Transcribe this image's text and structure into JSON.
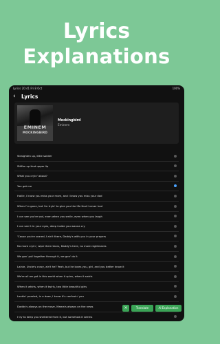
{
  "headline": {
    "line1": "Lyrics",
    "line2": "Explanations"
  },
  "status": {
    "carrier": "Lyrics",
    "time": "20:41",
    "date": "Fri 8 Oct",
    "right": "100%"
  },
  "nav": {
    "back_glyph": "‹",
    "title": "Lyrics"
  },
  "song": {
    "title": "Mockingbird",
    "artist": "Eminem",
    "cover_artist_text": "EMINEM",
    "cover_title_text": "MOCKINGBIRD"
  },
  "lyrics": [
    {
      "text": "Straighten up, little soldier",
      "checked": false
    },
    {
      "text": "Stiffen up that upper lip",
      "checked": false
    },
    {
      "text": "What you cryin' about?",
      "checked": false
    },
    {
      "text": "You got me",
      "checked": true
    },
    {
      "text": "Hailie, I know you miss your mom, and I know you miss your dad",
      "checked": false
    },
    {
      "text": "When I'm gone, but I'm tryin' to give you the life that I never had",
      "checked": false
    },
    {
      "text": "I can see you're sad, even when you smile, even when you laugh",
      "checked": false
    },
    {
      "text": "I can see it in your eyes, deep inside you wanna cry",
      "checked": false
    },
    {
      "text": "'Cause you're scared, I ain't there, Daddy's with you in your prayers",
      "checked": false
    },
    {
      "text": "No more cryin', wipe them tears, Daddy's here, no more nightmares",
      "checked": false
    },
    {
      "text": "We gon' pull together through it, we gon' do it",
      "checked": false
    },
    {
      "text": "Lainie, Uncle's crazy, ain't he? Yeah, but he loves you, girl, and you better know it",
      "checked": false
    },
    {
      "text": "We're all we got in this world when it spins, when it swirls",
      "checked": false
    },
    {
      "text": "When it whirls, when it twirls, two little beautiful girls",
      "checked": false
    },
    {
      "text": "Lookin' puzzled, in a daze, I know it's confusin' you",
      "checked": false
    },
    {
      "text": "Daddy's always on the move, Mama's always on the news",
      "checked": false
    },
    {
      "text": "I try to keep you sheltered from it, but somehow it seems",
      "checked": false
    }
  ],
  "actions": {
    "close_glyph": "×",
    "translate": "Translate",
    "explanation": "AI Explanation"
  },
  "colors": {
    "background": "#7dc896",
    "accent": "#3aa456",
    "check_on": "#4aa3ff"
  },
  "icons": {
    "back": "chevron-left-icon",
    "close": "close-icon",
    "check": "circle-check-icon"
  }
}
